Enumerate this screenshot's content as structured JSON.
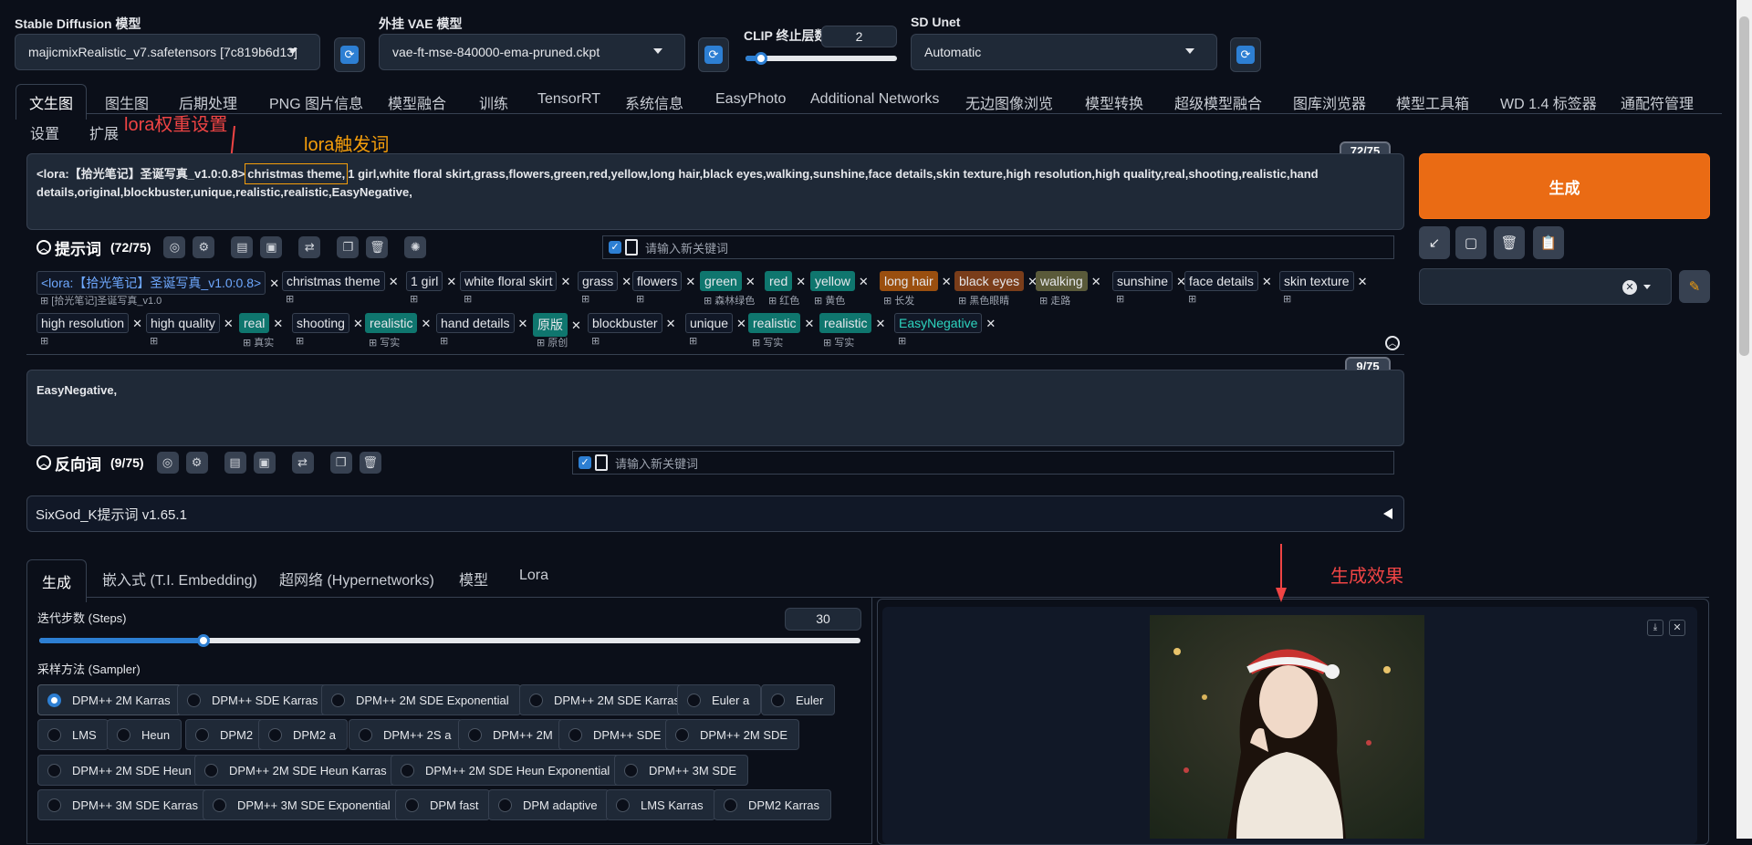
{
  "top": {
    "sd_model_label": "Stable Diffusion 模型",
    "sd_model_value": "majicmixRealistic_v7.safetensors [7c819b6d13]",
    "vae_label": "外挂 VAE 模型",
    "vae_value": "vae-ft-mse-840000-ema-pruned.ckpt",
    "clip_label": "CLIP 终止层数",
    "clip_value": "2",
    "clip_level": 0.1,
    "unet_label": "SD Unet",
    "unet_value": "Automatic"
  },
  "tabs": [
    "文生图",
    "图生图",
    "后期处理",
    "PNG 图片信息",
    "模型融合",
    "训练",
    "TensorRT",
    "系统信息",
    "EasyPhoto",
    "Additional Networks",
    "无边图像浏览",
    "模型转换",
    "超级模型融合",
    "图库浏览器",
    "模型工具箱",
    "WD 1.4 标签器",
    "通配符管理",
    "设置",
    "扩展"
  ],
  "annotations": {
    "lora_weight": "lora权重设置",
    "lora_trigger": "lora触发词",
    "gen_effect": "生成效果"
  },
  "prompt": {
    "counter": "72/75",
    "lora_part": "<lora:【拾光笔记】圣诞写真_v1.0:0.8>",
    "trigger": "christmas theme,",
    "rest_line1": "1 girl,white floral skirt,grass,flowers,green,red,yellow,long hair,black eyes,walking,sunshine,face details,skin texture,high resolution,high quality,real,shooting,realistic,hand",
    "line2": "details,original,blockbuster,unique,realistic,realistic,EasyNegative,",
    "title": "提示词",
    "count": "(72/75)",
    "new_kw_placeholder": "请输入新关键词"
  },
  "tags_row1": [
    {
      "t": "<lora:【拾光笔记】圣诞写真_v1.0:0.8>",
      "sub": "[拾光笔记]圣诞写真_v1.0",
      "style": "lora"
    },
    {
      "t": "christmas theme",
      "sub": "",
      "style": ""
    },
    {
      "t": "1 girl",
      "sub": "",
      "style": ""
    },
    {
      "t": "white floral skirt",
      "sub": "",
      "style": ""
    },
    {
      "t": "grass",
      "sub": "",
      "style": ""
    },
    {
      "t": "flowers",
      "sub": "",
      "style": ""
    },
    {
      "t": "green",
      "sub": "森林绿色",
      "style": "teal"
    },
    {
      "t": "red",
      "sub": "红色",
      "style": "teal"
    },
    {
      "t": "yellow",
      "sub": "黄色",
      "style": "teal"
    },
    {
      "t": "long hair",
      "sub": "长发",
      "style": "orange"
    },
    {
      "t": "black eyes",
      "sub": "黑色眼睛",
      "style": "brown"
    },
    {
      "t": "walking",
      "sub": "走路",
      "style": "olive"
    },
    {
      "t": "sunshine",
      "sub": "",
      "style": ""
    },
    {
      "t": "face details",
      "sub": "",
      "style": ""
    },
    {
      "t": "skin texture",
      "sub": "",
      "style": ""
    }
  ],
  "tags_row2": [
    {
      "t": "high resolution",
      "sub": "",
      "style": ""
    },
    {
      "t": "high quality",
      "sub": "",
      "style": ""
    },
    {
      "t": "real",
      "sub": "真实",
      "style": "teal"
    },
    {
      "t": "shooting",
      "sub": "",
      "style": ""
    },
    {
      "t": "realistic",
      "sub": "写实",
      "style": "teal"
    },
    {
      "t": "hand details",
      "sub": "",
      "style": ""
    },
    {
      "t": "原版",
      "sub": "原创",
      "style": "teal"
    },
    {
      "t": "blockbuster",
      "sub": "",
      "style": ""
    },
    {
      "t": "unique",
      "sub": "",
      "style": ""
    },
    {
      "t": "realistic",
      "sub": "写实",
      "style": "teal"
    },
    {
      "t": "realistic",
      "sub": "写实",
      "style": "teal"
    },
    {
      "t": "EasyNegative",
      "sub": "",
      "style": "emb"
    }
  ],
  "negative": {
    "counter": "9/75",
    "text": "EasyNegative,",
    "title": "反向词",
    "count": "(9/75)",
    "new_kw_placeholder": "请输入新关键词"
  },
  "generate_label": "生成",
  "sixgod": "SixGod_K提示词 v1.65.1",
  "subtabs": [
    "生成",
    "嵌入式 (T.I. Embedding)",
    "超网络 (Hypernetworks)",
    "模型",
    "Lora"
  ],
  "steps": {
    "label": "迭代步数 (Steps)",
    "value": "30",
    "level": 0.2
  },
  "sampler": {
    "label": "采样方法 (Sampler)",
    "rows": [
      [
        "DPM++ 2M Karras",
        "DPM++ SDE Karras",
        "DPM++ 2M SDE Exponential",
        "DPM++ 2M SDE Karras",
        "Euler a",
        "Euler"
      ],
      [
        "LMS",
        "Heun",
        "DPM2",
        "DPM2 a",
        "DPM++ 2S a",
        "DPM++ 2M",
        "DPM++ SDE",
        "DPM++ 2M SDE"
      ],
      [
        "DPM++ 2M SDE Heun",
        "DPM++ 2M SDE Heun Karras",
        "DPM++ 2M SDE Heun Exponential",
        "DPM++ 3M SDE"
      ],
      [
        "DPM++ 3M SDE Karras",
        "DPM++ 3M SDE Exponential",
        "DPM fast",
        "DPM adaptive",
        "LMS Karras",
        "DPM2 Karras"
      ]
    ],
    "selected": "DPM++ 2M Karras"
  },
  "colors": {
    "accent": "#2d7fd3",
    "generate": "#ea6b14",
    "annotation": "#ef4444"
  }
}
